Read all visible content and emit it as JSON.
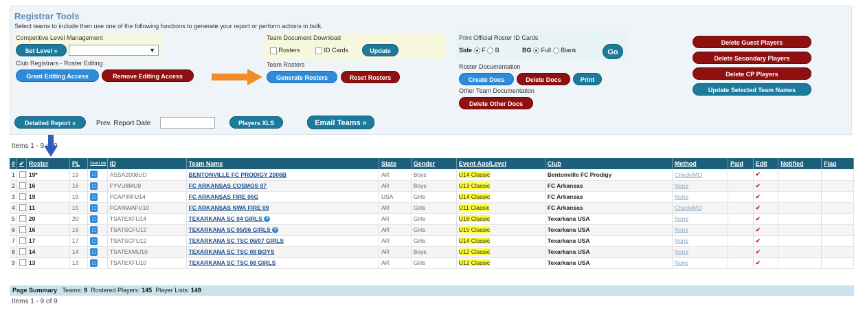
{
  "title": "Registrar Tools",
  "subtitle": "Select teams to include then use one of the following functions to generate your report or perform actions in bulk.",
  "competitive": {
    "label": "Competitive Level Management",
    "set_level": "Set Level »",
    "select_value": ""
  },
  "club_registrars": {
    "label": "Club Registrars - Roster Editing",
    "grant": "Grant Editing Access",
    "remove": "Remove Editing Access"
  },
  "team_doc_download": {
    "label": "Team Document Download",
    "rosters": "Rosters",
    "id_cards": "ID Cards",
    "update": "Update"
  },
  "team_rosters": {
    "label": "Team Rosters",
    "generate": "Generate Rosters",
    "reset": "Reset Rosters"
  },
  "print_cards": {
    "label": "Print Official Roster ID Cards",
    "side_label": "Side",
    "side_f": "F",
    "side_b": "B",
    "bg_label": "BG",
    "bg_full": "Full",
    "bg_blank": "Blank",
    "go": "Go"
  },
  "roster_docs": {
    "label": "Roster Documentation",
    "create": "Create Docs",
    "delete": "Delete Docs",
    "print": "Print"
  },
  "other_docs": {
    "label": "Other Team Documentation",
    "delete_other": "Delete Other Docs"
  },
  "bulk_actions": {
    "delete_guest": "Delete Guest Players",
    "delete_secondary": "Delete Secondary Players",
    "delete_cp": "Delete CP Players",
    "update_names": "Update Selected Team Names"
  },
  "reports": {
    "detailed": "Detailed Report »",
    "prev_date_label": "Prev. Report Date",
    "prev_date_value": "",
    "players_xls": "Players XLS",
    "email_teams": "Email Teams »"
  },
  "items_top": "Items 1 - 9 of 9",
  "items_bottom": "Items 1 - 9 of 9",
  "colors": {
    "accent": "#2f8bd8",
    "danger": "#8e1010",
    "header": "#1c5f7a",
    "arrow_orange": "#f28c28",
    "arrow_blue": "#2e5fb8"
  },
  "table": {
    "headers": [
      "#",
      "✔",
      "Roster",
      "PL",
      "Card Link",
      "ID",
      "Team Name",
      "State",
      "Gender",
      "Event Age/Level",
      "Club",
      "Method",
      "Paid",
      "Edit",
      "Notified",
      "Flag"
    ],
    "rows": [
      {
        "n": "1",
        "roster": "19*",
        "pl": "19",
        "id": "ASSA2006UD",
        "team": "BENTONVILLE FC PRODIGY 2006B",
        "state": "AR",
        "gender": "Boys",
        "event": "U14 Classic",
        "club": "Bentonville FC Prodigy",
        "method": "Check/MO",
        "info": ""
      },
      {
        "n": "2",
        "roster": "16",
        "pl": "16",
        "id": "FYVU8MU9",
        "team": "FC ARKANSAS COSMOS 07",
        "state": "AR",
        "gender": "Boys",
        "event": "U13 Classic",
        "club": "FC Arkansas",
        "method": "None",
        "info": ""
      },
      {
        "n": "3",
        "roster": "19",
        "pl": "19",
        "id": "FCAPIRFU14",
        "team": "FC ARKANSAS FIRE 06G",
        "state": "USA",
        "gender": "Girls",
        "event": "U14 Classic",
        "club": "FC Arkansas",
        "method": "None",
        "info": ""
      },
      {
        "n": "4",
        "roster": "11",
        "pl": "15",
        "id": "FCANWAFU10",
        "team": "FC ARKANSAS NWA FIRE 09",
        "state": "AR",
        "gender": "Girls",
        "event": "U11 Classic",
        "club": "FC Arkansas",
        "method": "Check/MO",
        "info": ""
      },
      {
        "n": "5",
        "roster": "20",
        "pl": "20",
        "id": "TSATEXFU14",
        "team": "TEXARKANA SC 04 GIRLS",
        "state": "AR",
        "gender": "Girls",
        "event": "U16 Classic",
        "club": "Texarkana USA",
        "method": "None",
        "info": "?"
      },
      {
        "n": "6",
        "roster": "16",
        "pl": "16",
        "id": "TSATSCFU12",
        "team": "TEXARKANA SC 05/06 GIRLS",
        "state": "AR",
        "gender": "Girls",
        "event": "U15 Classic",
        "club": "Texarkana USA",
        "method": "None",
        "info": "?"
      },
      {
        "n": "7",
        "roster": "17",
        "pl": "17",
        "id": "TSATSCFU12",
        "team": "TEXARKANA SC TSC 06/07 GIRLS",
        "state": "AR",
        "gender": "Girls",
        "event": "U14 Classic",
        "club": "Texarkana USA",
        "method": "None",
        "info": ""
      },
      {
        "n": "8",
        "roster": "14",
        "pl": "14",
        "id": "TSATEXMU10",
        "team": "TEXARKANA SC TSC 08 BOYS",
        "state": "AR",
        "gender": "Boys",
        "event": "U12 Classic",
        "club": "Texarkana USA",
        "method": "None",
        "info": ""
      },
      {
        "n": "9",
        "roster": "13",
        "pl": "13",
        "id": "TSATEXFU10",
        "team": "TEXARKANA SC TSC 08 GIRLS",
        "state": "AR",
        "gender": "Girls",
        "event": "U12 Classic",
        "club": "Texarkana USA",
        "method": "None",
        "info": ""
      }
    ],
    "summary": {
      "label": "Page Summary",
      "teams_label": "Teams:",
      "teams": "9",
      "rostered_label": "Rostered Players:",
      "rostered": "145",
      "player_lists_label": "Player Lists:",
      "player_lists": "149"
    }
  }
}
